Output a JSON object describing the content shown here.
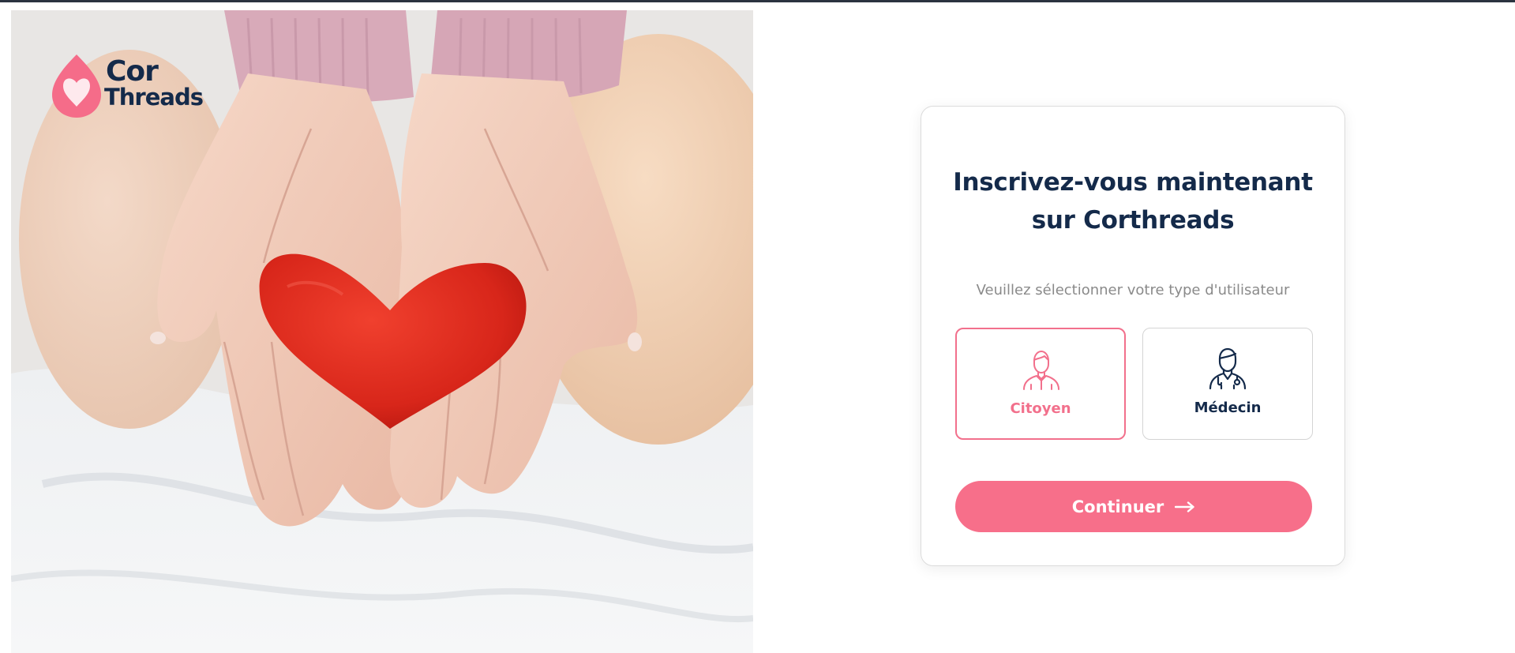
{
  "brand": {
    "name_line1": "Cor",
    "name_line2": "Threads",
    "colors": {
      "navy": "#142a4a",
      "pink": "#f76f8a",
      "pink_selected": "#f2708c"
    }
  },
  "hero": {
    "image_icon": "hands-holding-heart-image"
  },
  "card": {
    "title_line1": "Inscrivez-vous maintenant",
    "title_line2": "sur Corthreads",
    "subtitle": "Veuillez sélectionner votre type d'utilisateur",
    "options": [
      {
        "label": "Citoyen",
        "icon": "citizen-user-icon",
        "selected": true
      },
      {
        "label": "Médecin",
        "icon": "doctor-user-icon",
        "selected": false
      }
    ],
    "continue_label": "Continuer",
    "continue_icon": "arrow-right-icon"
  }
}
